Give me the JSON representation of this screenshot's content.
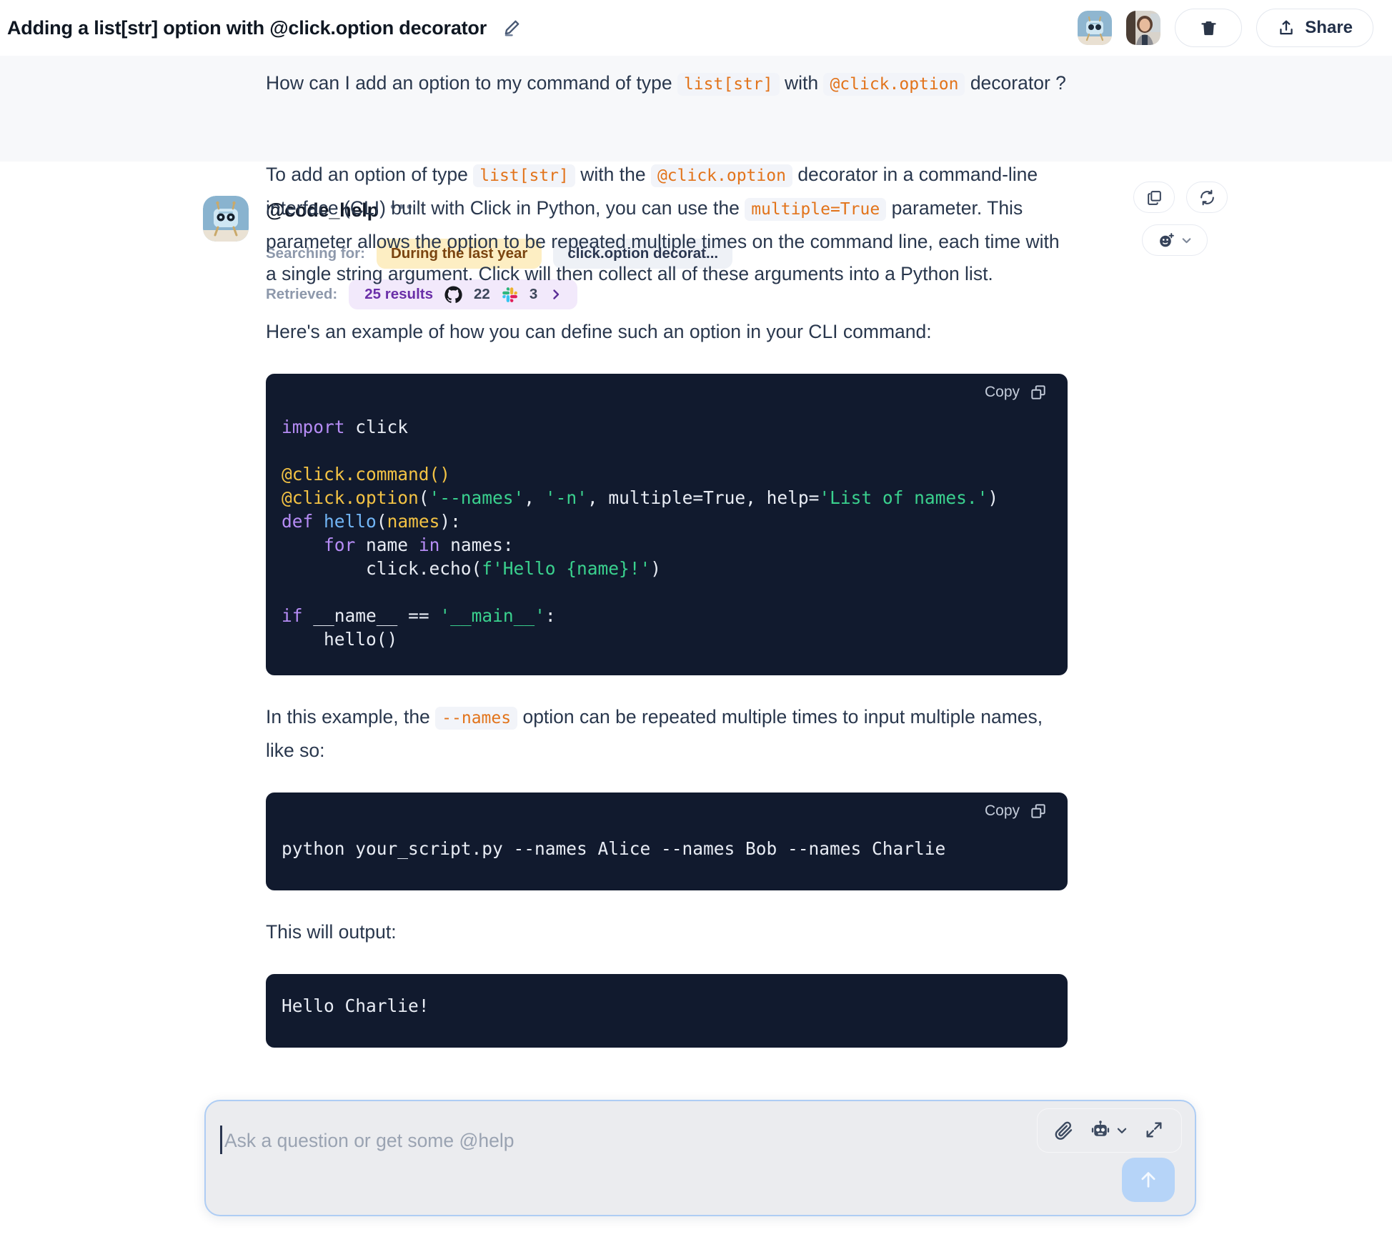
{
  "topbar": {
    "title": "Adding a list[str] option with @click.option decorator",
    "edit_icon": "pencil-icon",
    "bot_avatar_alt": "code_help-bot-avatar",
    "user_avatar_alt": "user-avatar",
    "delete_icon": "trash-icon",
    "share_label": "Share",
    "share_icon": "upload-share-icon"
  },
  "user_message": {
    "text_1": "How can I add an option to my command of type ",
    "code_1": "list[str]",
    "text_2": " with ",
    "code_2": "@click.option",
    "text_3": " decorator ?"
  },
  "agent": {
    "name": "@code_help",
    "overflow_icon": "more-options-icon",
    "searching_label": "Searching for:",
    "chips": [
      {
        "label": "During the last year",
        "style": "year"
      },
      {
        "label": "click.option decorat...",
        "style": "query"
      }
    ],
    "retrieved_label": "Retrieved:",
    "retrieved": {
      "results": "25 results",
      "github_count": "22",
      "slack_count": "3",
      "expand_icon": "chevron-right-icon"
    },
    "actions": {
      "copy_icon": "copy-icon",
      "refresh_icon": "refresh-icon",
      "react_icon": "add-reaction-icon",
      "react_chevron": "chevron-down-icon"
    }
  },
  "body": {
    "para1": {
      "t1": "To add an option of type ",
      "c1": "list[str]",
      "t2": " with the ",
      "c2": "@click.option",
      "t3": " decorator in a command-line interface (CLI) built with Click in Python, you can use the ",
      "c3": "multiple=True",
      "t4": " parameter. This parameter allows the option to be repeated multiple times on the command line, each time with a single string argument. Click will then collect all of these arguments into a Python list."
    },
    "para2": "Here's an example of how you can define such an option in your CLI command:",
    "code_block_1": {
      "copy_label": "Copy",
      "copy_icon": "copy-icon",
      "language": "python",
      "lines": [
        "import click",
        "",
        "@click.command()",
        "@click.option('--names', '-n', multiple=True, help='List of names.')",
        "def hello(names):",
        "    for name in names:",
        "        click.echo(f'Hello {name}!')",
        "",
        "if __name__ == '__main__':",
        "    hello()"
      ]
    },
    "para3": {
      "t1": "In this example, the ",
      "c1": "--names",
      "t2": " option can be repeated multiple times to input multiple names, like so:"
    },
    "code_block_2": {
      "copy_label": "Copy",
      "copy_icon": "copy-icon",
      "lines": [
        "python your_script.py --names Alice --names Bob --names Charlie"
      ]
    },
    "para4": "This will output:",
    "code_block_3": {
      "lines": [
        "Hello Charlie!"
      ]
    }
  },
  "composer": {
    "placeholder": "Ask a question or get some @help",
    "value": "",
    "attach_icon": "paperclip-icon",
    "bot_icon": "robot-icon",
    "bot_chevron": "chevron-down-icon",
    "expand_icon": "expand-diagonal-icon",
    "send_icon": "arrow-up-icon"
  },
  "colors": {
    "inline_code_text": "#e2731a",
    "inline_code_bg": "#f2f4f9",
    "code_bg": "#111a2e",
    "chip_year_bg": "#fdeec3",
    "chip_retrieved_bg": "#f2e9fb",
    "accent_purple": "#6a2fa8",
    "send_bg": "#b6d4f8",
    "composer_border": "#aecdf4",
    "user_band_bg": "#f7f8fa",
    "body_text": "#29374d"
  }
}
